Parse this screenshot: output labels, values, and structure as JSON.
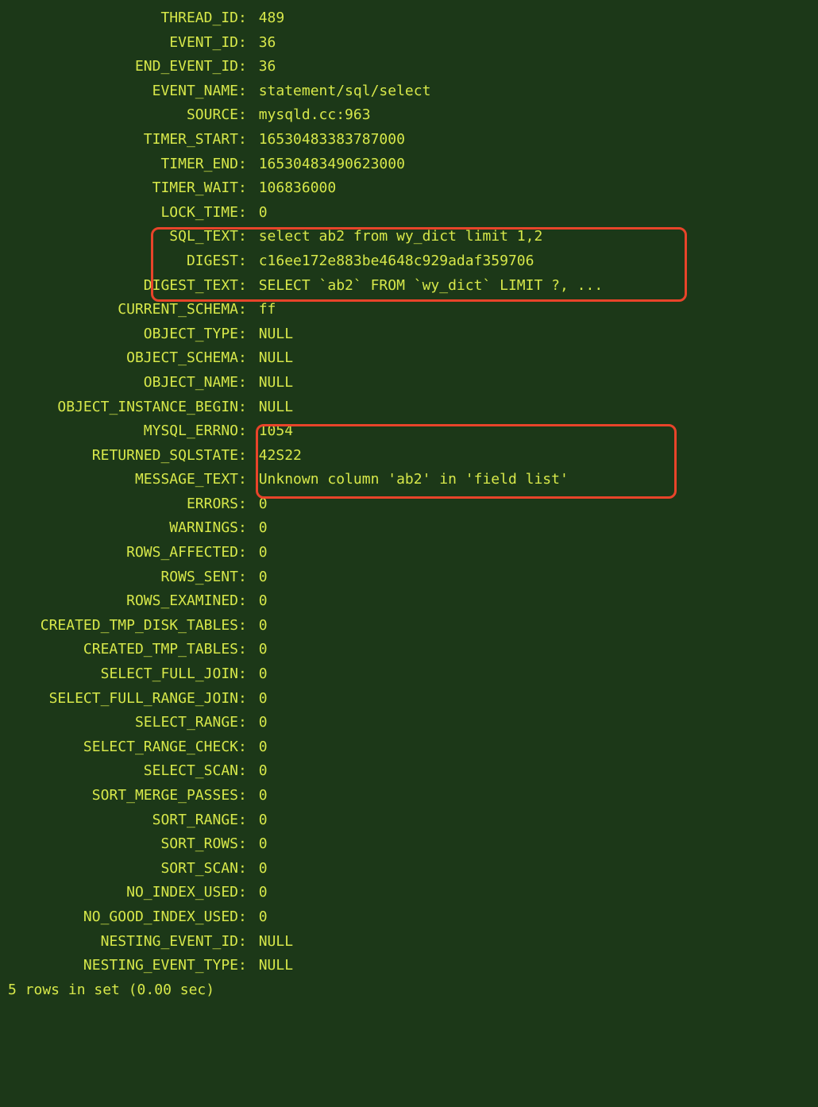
{
  "rows": [
    {
      "label": "THREAD_ID",
      "value": "489"
    },
    {
      "label": "EVENT_ID",
      "value": "36"
    },
    {
      "label": "END_EVENT_ID",
      "value": "36"
    },
    {
      "label": "EVENT_NAME",
      "value": "statement/sql/select"
    },
    {
      "label": "SOURCE",
      "value": "mysqld.cc:963"
    },
    {
      "label": "TIMER_START",
      "value": "16530483383787000"
    },
    {
      "label": "TIMER_END",
      "value": "16530483490623000"
    },
    {
      "label": "TIMER_WAIT",
      "value": "106836000"
    },
    {
      "label": "LOCK_TIME",
      "value": "0"
    },
    {
      "label": "SQL_TEXT",
      "value": "select ab2 from wy_dict limit 1,2"
    },
    {
      "label": "DIGEST",
      "value": "c16ee172e883be4648c929adaf359706"
    },
    {
      "label": "DIGEST_TEXT",
      "value": "SELECT `ab2` FROM `wy_dict` LIMIT ?, ..."
    },
    {
      "label": "CURRENT_SCHEMA",
      "value": "ff"
    },
    {
      "label": "OBJECT_TYPE",
      "value": "NULL"
    },
    {
      "label": "OBJECT_SCHEMA",
      "value": "NULL"
    },
    {
      "label": "OBJECT_NAME",
      "value": "NULL"
    },
    {
      "label": "OBJECT_INSTANCE_BEGIN",
      "value": "NULL"
    },
    {
      "label": "MYSQL_ERRNO",
      "value": "1054"
    },
    {
      "label": "RETURNED_SQLSTATE",
      "value": "42S22"
    },
    {
      "label": "MESSAGE_TEXT",
      "value": "Unknown column 'ab2' in 'field list'"
    },
    {
      "label": "ERRORS",
      "value": "0"
    },
    {
      "label": "WARNINGS",
      "value": "0"
    },
    {
      "label": "ROWS_AFFECTED",
      "value": "0"
    },
    {
      "label": "ROWS_SENT",
      "value": "0"
    },
    {
      "label": "ROWS_EXAMINED",
      "value": "0"
    },
    {
      "label": "CREATED_TMP_DISK_TABLES",
      "value": "0"
    },
    {
      "label": "CREATED_TMP_TABLES",
      "value": "0"
    },
    {
      "label": "SELECT_FULL_JOIN",
      "value": "0"
    },
    {
      "label": "SELECT_FULL_RANGE_JOIN",
      "value": "0"
    },
    {
      "label": "SELECT_RANGE",
      "value": "0"
    },
    {
      "label": "SELECT_RANGE_CHECK",
      "value": "0"
    },
    {
      "label": "SELECT_SCAN",
      "value": "0"
    },
    {
      "label": "SORT_MERGE_PASSES",
      "value": "0"
    },
    {
      "label": "SORT_RANGE",
      "value": "0"
    },
    {
      "label": "SORT_ROWS",
      "value": "0"
    },
    {
      "label": "SORT_SCAN",
      "value": "0"
    },
    {
      "label": "NO_INDEX_USED",
      "value": "0"
    },
    {
      "label": "NO_GOOD_INDEX_USED",
      "value": "0"
    },
    {
      "label": "NESTING_EVENT_ID",
      "value": "NULL"
    },
    {
      "label": "NESTING_EVENT_TYPE",
      "value": "NULL"
    }
  ],
  "footer": "5 rows in set (0.00 sec)"
}
